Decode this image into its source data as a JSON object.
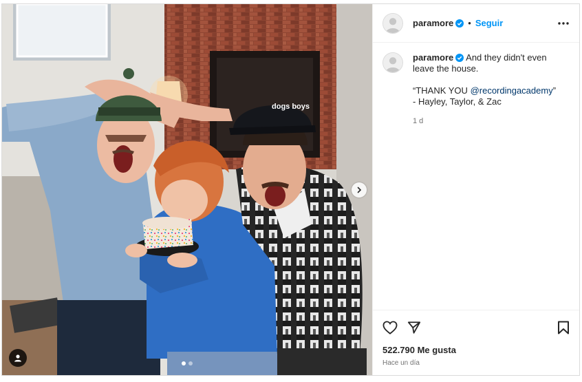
{
  "post": {
    "username": "paramore",
    "follow_label": "Seguir",
    "separator": "•",
    "caption_text": "And they didn't even leave the house.",
    "caption_line2": "“THANK YOU ",
    "caption_mention": "@recordingacademy",
    "caption_line2_end": "” - Hayley, Taylor, & Zac",
    "caption_time": "1 d",
    "likes": "522.790 Me gusta",
    "time_ago": "Hace un día"
  },
  "media": {
    "cap_text": "dogs boys",
    "carousel_count": 2,
    "carousel_index": 1
  },
  "icons": [
    "verified-badge-icon",
    "more-options-icon",
    "heart-icon",
    "share-icon",
    "bookmark-icon",
    "user-tag-icon",
    "chevron-right-icon"
  ],
  "colors": {
    "link": "#0095f6",
    "verified": "#0095f6",
    "mention": "#00376b"
  }
}
